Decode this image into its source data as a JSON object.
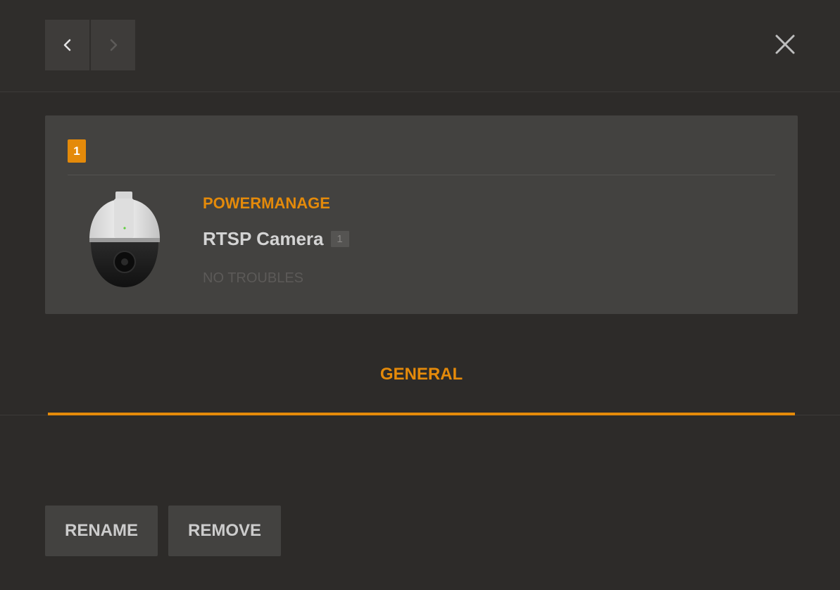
{
  "header": {
    "prev_icon": "chevron-left-icon",
    "next_icon": "chevron-right-icon",
    "close_icon": "close-icon"
  },
  "device": {
    "zone_number": "1",
    "brand": "POWERMANAGE",
    "name": "RTSP Camera",
    "id_badge": "1",
    "status": "NO TROUBLES",
    "image": "ptz-dome-camera"
  },
  "tabs": [
    {
      "label": "GENERAL",
      "active": true
    }
  ],
  "actions": {
    "rename_label": "RENAME",
    "remove_label": "REMOVE"
  },
  "colors": {
    "accent": "#e48a0a",
    "background": "#2d2b29",
    "card": "#434240"
  }
}
